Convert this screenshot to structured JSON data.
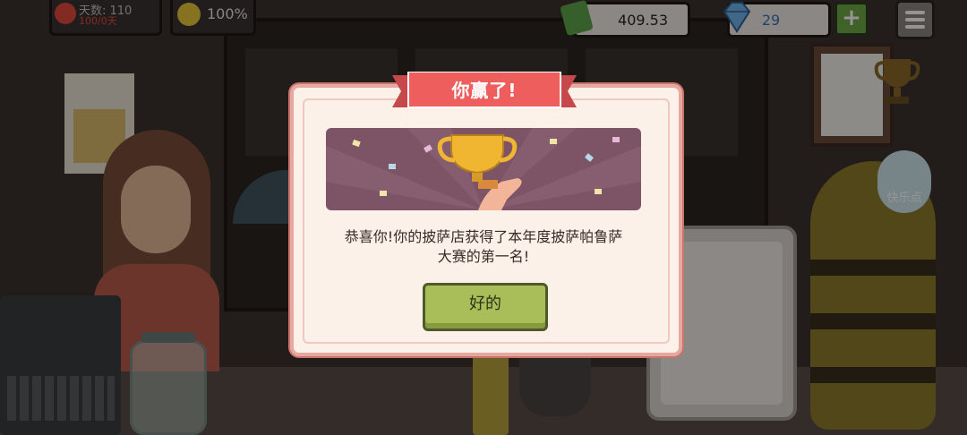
{
  "hud": {
    "days_label": "天数: 110",
    "days_sub": "100/0天",
    "happiness": "100%",
    "money": "409.53",
    "gems": "29",
    "plus_label": "+",
    "icons": [
      "gear-icon",
      "smile-icon",
      "cash-icon",
      "gem-icon",
      "plus-icon",
      "menu-icon"
    ]
  },
  "dialog": {
    "title": "你赢了!",
    "message_line1": "恭喜你!你的披萨店获得了本年度披萨帕鲁萨",
    "message_line2": "大赛的第一名!",
    "ok_label": "好的",
    "image": "trophy-celebration-image"
  },
  "scene": {
    "speech_bubble": "快乐点"
  },
  "colors": {
    "ribbon": "#e85a5a",
    "button": "#a9be58",
    "dialog_bg": "#fbf1e9",
    "money_text": "#2a2624",
    "gem_text": "#3a74b8"
  }
}
